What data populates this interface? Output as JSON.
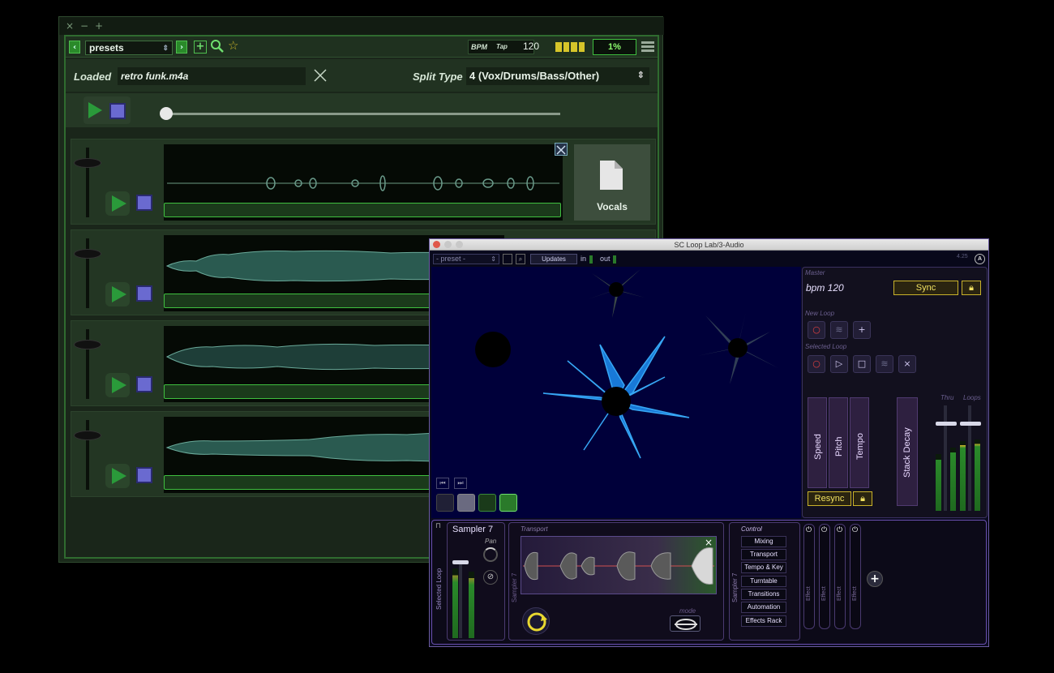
{
  "splitter": {
    "toolbar": {
      "back_label": "‹",
      "forward_label": "›",
      "preset_select": "presets",
      "bpm_label": "BPM",
      "tap_label": "Tap",
      "bpm_value": "120",
      "cpu_value": "1%"
    },
    "loaded_label": "Loaded",
    "loaded_file": "retro funk.m4a",
    "split_type_label": "Split Type",
    "split_type_value": "4 (Vox/Drums/Bass/Other)",
    "tracks": [
      {
        "stem_label": "Vocals"
      }
    ],
    "colors": {
      "accent": "#3fbf3f",
      "background": "#1a261a"
    }
  },
  "looplab": {
    "window_title": "SC Loop Lab/3-Audio",
    "preset_select": "- preset -",
    "updates_label": "Updates",
    "in_label": "in",
    "out_label": "out",
    "version": "4.25",
    "version_badge": "A",
    "master_label": "Master",
    "bpm_text": "bpm 120",
    "sync_label": "Sync",
    "new_loop_label": "New Loop",
    "selected_loop_label": "Selected Loop",
    "sliders": [
      "Speed",
      "Pitch",
      "Tempo"
    ],
    "stack_decay_label": "Stack Decay",
    "resync_label": "Resync",
    "thru_label": "Thru",
    "loops_label": "Loops",
    "sampler_title": "Sampler 7",
    "pan_label": "Pan",
    "selected_loop_vertical": "Selected Loop",
    "transport_label": "Transport",
    "transport_vertical": "Sampler 7",
    "mode_label": "mode",
    "control_label": "Control",
    "control_vertical": "Sampler 7",
    "control_buttons": [
      "Mixing",
      "Transport",
      "Tempo & Key",
      "Turntable",
      "Transitions",
      "Automation",
      "Effects Rack"
    ],
    "effects": [
      "Effect",
      "Effect",
      "Effect",
      "Effect"
    ],
    "colors": {
      "accent": "#c9b22a",
      "frame": "#6a50b0"
    }
  }
}
